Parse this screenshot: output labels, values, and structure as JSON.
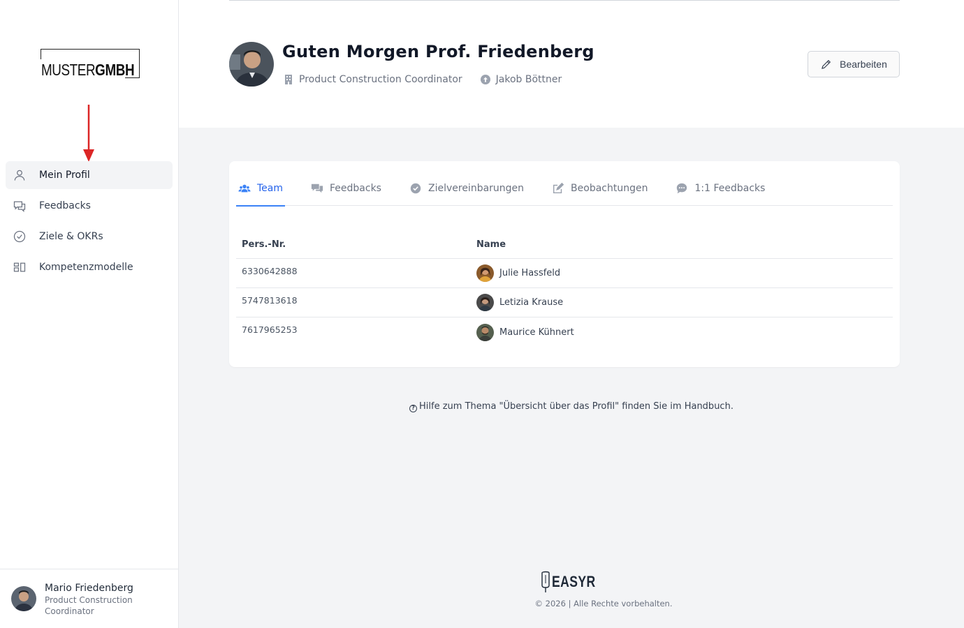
{
  "brand": {
    "logo_light": "MUSTER",
    "logo_bold": "GMBH"
  },
  "sidebar": {
    "items": [
      {
        "label": "Mein Profil",
        "icon": "user-icon",
        "active": true
      },
      {
        "label": "Feedbacks",
        "icon": "chat-bubbles-icon"
      },
      {
        "label": "Ziele & OKRs",
        "icon": "check-circle-icon"
      },
      {
        "label": "Kompetenzmodelle",
        "icon": "grid-icon"
      }
    ],
    "user": {
      "name": "Mario Friedenberg",
      "role": "Product Construction Coordinator"
    }
  },
  "header": {
    "greeting": "Guten Morgen Prof. Friedenberg",
    "position": "Product Construction Coordinator",
    "manager": "Jakob Böttner",
    "edit_label": "Bearbeiten"
  },
  "tabs": [
    {
      "label": "Team",
      "icon": "users-icon",
      "active": true
    },
    {
      "label": "Feedbacks",
      "icon": "comments-icon"
    },
    {
      "label": "Zielvereinbarungen",
      "icon": "check-circle-icon"
    },
    {
      "label": "Beobachtungen",
      "icon": "edit-icon"
    },
    {
      "label": "1:1 Feedbacks",
      "icon": "comment-dots-icon"
    }
  ],
  "table": {
    "headers": [
      "Pers.-Nr.",
      "Name"
    ],
    "rows": [
      {
        "id": "6330642888",
        "name": "Julie Hassfeld"
      },
      {
        "id": "5747813618",
        "name": "Letizia Krause"
      },
      {
        "id": "7617965253",
        "name": "Maurice Kühnert"
      }
    ]
  },
  "help": {
    "text": "Hilfe zum Thema \"Übersicht über das Profil\" finden Sie im Handbuch."
  },
  "footer": {
    "brand": "EASYR",
    "copyright": "© 2026 | Alle Rechte vorbehalten."
  },
  "colors": {
    "accent": "#3b82f6",
    "annotation_arrow": "#dc2626"
  }
}
